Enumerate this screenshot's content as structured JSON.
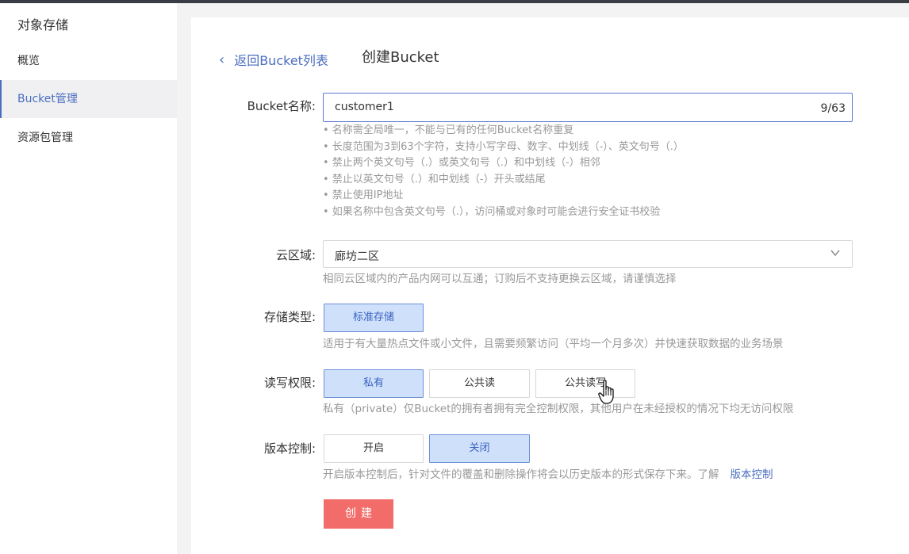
{
  "sidebar": {
    "title": "对象存储",
    "items": [
      {
        "label": "概览"
      },
      {
        "label": "Bucket管理"
      },
      {
        "label": "资源包管理"
      }
    ]
  },
  "header": {
    "back_label": "返回Bucket列表",
    "title": "创建Bucket"
  },
  "form": {
    "name": {
      "label": "Bucket名称:",
      "value": "customer1",
      "counter": "9/63",
      "hints": [
        "• 名称需全局唯一，不能与已有的任何Bucket名称重复",
        "• 长度范围为3到63个字符，支持小写字母、数字、中划线（-）、英文句号（.）",
        "• 禁止两个英文句号（.）或英文句号（.）和中划线（-）相邻",
        "• 禁止以英文句号（.）和中划线（-）开头或结尾",
        "• 禁止使用IP地址",
        "• 如果名称中包含英文句号（.），访问桶或对象时可能会进行安全证书校验"
      ]
    },
    "region": {
      "label": "云区域:",
      "value": "廊坊二区",
      "desc": "相同云区域内的产品内网可以互通；订购后不支持更换云区域，请谨慎选择"
    },
    "storage": {
      "label": "存储类型:",
      "option": "标准存储",
      "desc": "适用于有大量热点文件或小文件，且需要频繁访问（平均一个月多次）并快速获取数据的业务场景"
    },
    "acl": {
      "label": "读写权限:",
      "options": [
        "私有",
        "公共读",
        "公共读写"
      ],
      "selected": "私有",
      "desc": "私有（private）仅Bucket的拥有者拥有完全控制权限，其他用户在未经授权的情况下均无访问权限"
    },
    "versioning": {
      "label": "版本控制:",
      "options": [
        "开启",
        "关闭"
      ],
      "selected": "关闭",
      "desc": "开启版本控制后，针对文件的覆盖和删除操作将会以历史版本的形式保存下来。了解",
      "link": "版本控制"
    },
    "submit_label": "创建"
  },
  "colors": {
    "accent": "#4a6dc0",
    "selected_bg": "#cfe0fb",
    "primary_button": "#f26d6a",
    "hint_text": "#999999"
  },
  "icons": {
    "back": "chevron-left-icon",
    "dropdown": "chevron-down-icon",
    "cursor": "hand-pointer-cursor"
  }
}
